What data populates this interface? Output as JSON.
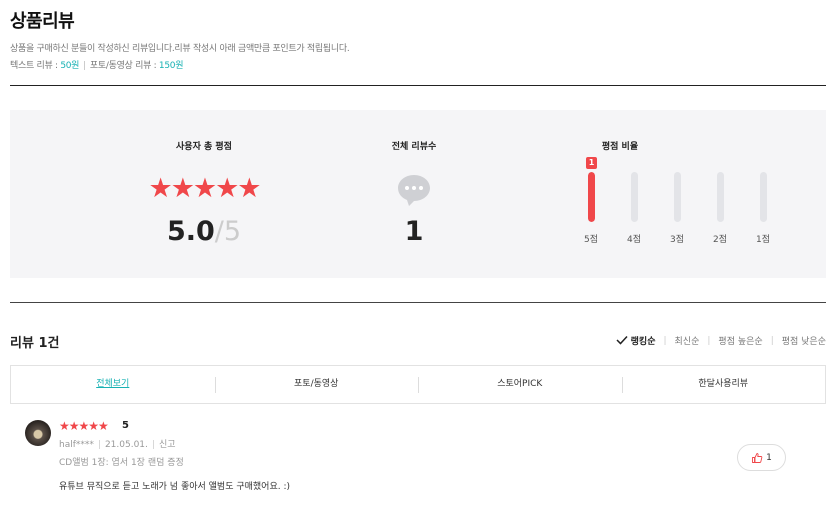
{
  "header": {
    "title": "상품리뷰",
    "notice": "상품을 구매하신 분들이 작성하신 리뷰입니다.리뷰 작성시 아래 금액만큼 포인트가 적립됩니다.",
    "text_review_label": "텍스트 리뷰 : ",
    "text_review_amount": "50원",
    "photo_review_label": "포토/동영상 리뷰 : ",
    "photo_review_amount": "150원",
    "separator": "|"
  },
  "summary": {
    "avg_title": "사용자 총 평점",
    "avg_stars": "★★★★★",
    "avg_value": "5.0",
    "avg_max": "/5",
    "count_title": "전체 리뷰수",
    "count_value": "1",
    "ratio_title": "평점 비율",
    "ratio_bars": [
      {
        "label": "5점",
        "fraction": 1.0,
        "badge": "1"
      },
      {
        "label": "4점",
        "fraction": 0
      },
      {
        "label": "3점",
        "fraction": 0
      },
      {
        "label": "2점",
        "fraction": 0
      },
      {
        "label": "1점",
        "fraction": 0
      }
    ]
  },
  "reviews_header": {
    "count_label": "리뷰 1건",
    "sort_options": [
      {
        "label": "랭킹순",
        "active": true
      },
      {
        "label": "최신순",
        "active": false
      },
      {
        "label": "평점 높은순",
        "active": false
      },
      {
        "label": "평점 낮은순",
        "active": false
      }
    ]
  },
  "tabs": [
    {
      "label": "전체보기",
      "active": true
    },
    {
      "label": "포토/동영상",
      "active": false
    },
    {
      "label": "스토어PICK",
      "active": false
    },
    {
      "label": "한달사용리뷰",
      "active": false
    }
  ],
  "review": {
    "stars": "★★★★★",
    "score": "5",
    "author": "half****",
    "date": "21.05.01.",
    "report": "신고",
    "option": "CD앨범 1장: 엽서 1장 랜덤 증정",
    "body": "유튜브 뮤직으로 듣고 노래가 넘 좋아서 앨범도 구매했어요. :)",
    "likes": "1"
  },
  "colors": {
    "accent": "#f0474a",
    "teal": "#17b1b3",
    "panel_bg": "#f5f5f7"
  }
}
